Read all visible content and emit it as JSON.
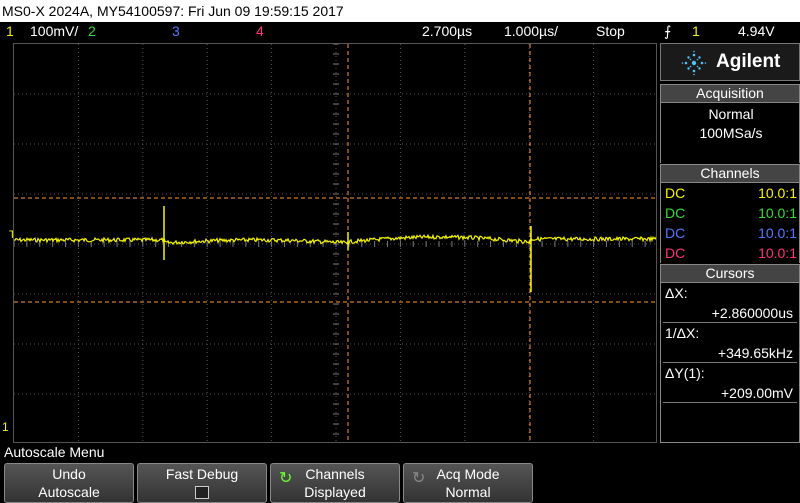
{
  "title_bar": "MS0-X 2024A, MY54100597: Fri Jun 09 19:59:15 2017",
  "status": {
    "ch1_num": "1",
    "ch1_scale": "100mV/",
    "ch2_num": "2",
    "ch3_num": "3",
    "ch4_num": "4",
    "time_offset": "2.700µs",
    "time_scale": "1.000µs/",
    "run_state": "Stop",
    "trigger_icon": "trigger-edge-icon",
    "trigger_source": "1",
    "trigger_level": "4.94V"
  },
  "screen": {
    "ground_marker": "1",
    "trigger_marker": "T"
  },
  "brand": {
    "name": "Agilent"
  },
  "acquisition": {
    "header": "Acquisition",
    "mode": "Normal",
    "rate": "100MSa/s"
  },
  "channels": {
    "header": "Channels",
    "rows": [
      {
        "coupling": "DC",
        "probe": "10.0:1",
        "color": "#f5f500"
      },
      {
        "coupling": "DC",
        "probe": "10.0:1",
        "color": "#33dd33"
      },
      {
        "coupling": "DC",
        "probe": "10.0:1",
        "color": "#5577ff"
      },
      {
        "coupling": "DC",
        "probe": "10.0:1",
        "color": "#ff3377"
      }
    ]
  },
  "cursors": {
    "header": "Cursors",
    "dx_label": "ΔX:",
    "dx_value": "+2.860000us",
    "inv_dx_label": "1/ΔX:",
    "inv_dx_value": "+349.65kHz",
    "dy_label": "ΔY(1):",
    "dy_value": "+209.00mV"
  },
  "menu": {
    "title": "Autoscale Menu",
    "keys": [
      {
        "line1": "Undo",
        "line2": "Autoscale"
      },
      {
        "line1": "Fast Debug",
        "line2": ""
      },
      {
        "line1": "Channels",
        "line2": "Displayed"
      },
      {
        "line1": "Acq Mode",
        "line2": "Normal"
      }
    ]
  },
  "colors": {
    "ch1": "#f5f500",
    "ch2": "#33dd33",
    "ch3": "#5577ff",
    "ch4": "#ff3377",
    "cursor": "#ff9933",
    "grid": "#555555"
  }
}
